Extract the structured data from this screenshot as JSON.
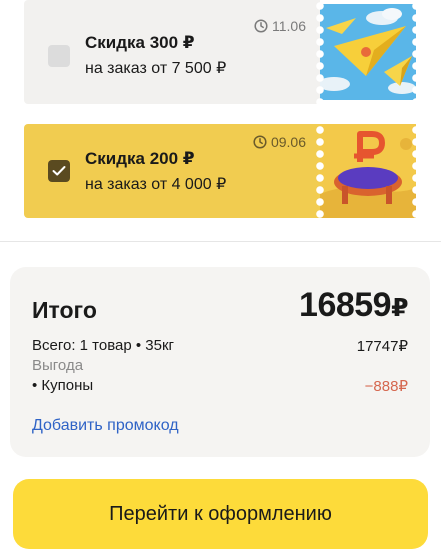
{
  "coupons": [
    {
      "title": "Скидка 300 ₽",
      "subtitle": "на заказ от 7 500 ₽",
      "date": "11.06",
      "checked": false
    },
    {
      "title": "Скидка 200 ₽",
      "subtitle": "на заказ от 4 000 ₽",
      "date": "09.06",
      "checked": true
    }
  ],
  "summary": {
    "total_label": "Итого",
    "total_value": "16859",
    "currency": "₽",
    "items_label": "Всего: 1 товар • 35кг",
    "items_value": "17747₽",
    "benefit_label": "Выгода",
    "coupons_label": "• Купоны",
    "coupons_value": "−888₽",
    "promo_link": "Добавить промокод"
  },
  "checkout": {
    "label": "Перейти к оформлению"
  },
  "colors": {
    "accent": "#fddb3a",
    "coupon_active": "#f1cc50",
    "link": "#2f63c6",
    "discount": "#d5674f"
  }
}
